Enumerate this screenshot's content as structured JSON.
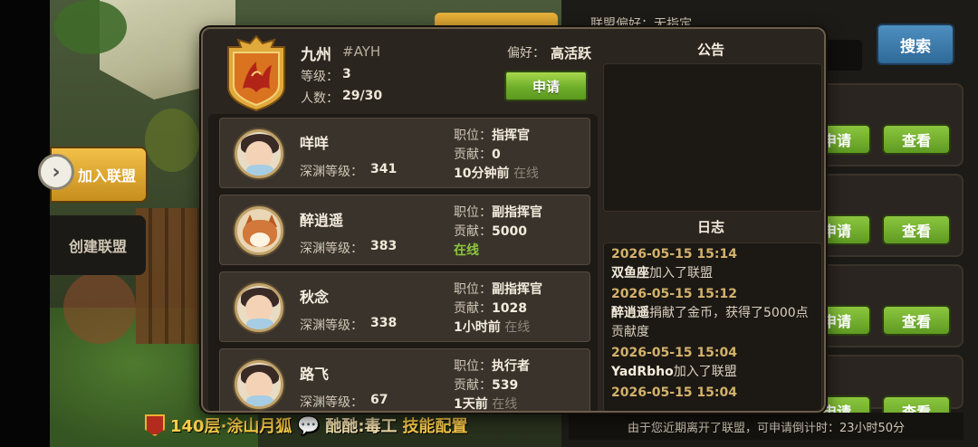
{
  "background": {
    "join_label": "加入联盟",
    "create_label": "创建联盟",
    "search_label": "搜索",
    "right_pref_text": "联盟偏好：无指定",
    "right_buttons": [
      {
        "apply": "申请",
        "view": "查看"
      },
      {
        "apply": "申请",
        "view": "查看"
      },
      {
        "apply": "申请",
        "view": "查看"
      },
      {
        "apply": "申请",
        "view": "查看"
      }
    ],
    "chat_text": "140层·涂山月狐",
    "chat_user": "酏酏:毒工",
    "chat_tail": "技能配置",
    "cooldown_notice": "由于您近期离开了联盟，可申请倒计时：23小时50分"
  },
  "guild": {
    "name": "九州",
    "tag": "#AYH",
    "level_label": "等级：",
    "level": "3",
    "members_label": "人数：",
    "members": "29/30",
    "preference_label": "偏好：",
    "preference": "高活跃",
    "apply_button": "申请"
  },
  "members": [
    {
      "name": "咩咩",
      "abyss_label": "深渊等级：",
      "abyss": "341",
      "role_label": "职位：",
      "role": "指挥官",
      "contrib_label": "贡献：",
      "contrib": "0",
      "last_seen": "10分钟前",
      "status": "在线",
      "avatar": "hero"
    },
    {
      "name": "醉逍遥",
      "abyss_label": "深渊等级：",
      "abyss": "383",
      "role_label": "职位：",
      "role": "副指挥官",
      "contrib_label": "贡献：",
      "contrib": "5000",
      "last_seen": "",
      "status": "在线",
      "avatar": "fox"
    },
    {
      "name": "秋念",
      "abyss_label": "深渊等级：",
      "abyss": "338",
      "role_label": "职位：",
      "role": "副指挥官",
      "contrib_label": "贡献：",
      "contrib": "1028",
      "last_seen": "1小时前",
      "status": "在线",
      "avatar": "hero"
    },
    {
      "name": "路飞",
      "abyss_label": "深渊等级：",
      "abyss": "67",
      "role_label": "职位：",
      "role": "执行者",
      "contrib_label": "贡献：",
      "contrib": "539",
      "last_seen": "1天前",
      "status": "在线",
      "avatar": "hero"
    }
  ],
  "announcement": {
    "title": "公告",
    "body": ""
  },
  "log": {
    "title": "日志",
    "entries": [
      {
        "time": "2026-05-15 15:14",
        "actor": "双鱼座",
        "text": "加入了联盟"
      },
      {
        "time": "2026-05-15 15:12",
        "actor": "醉逍遥",
        "text": "捐献了金币，获得了5000点贡献度"
      },
      {
        "time": "2026-05-15 15:04",
        "actor": "YadRbho",
        "text": "加入了联盟"
      },
      {
        "time": "2026-05-15 15:04",
        "actor": "",
        "text": ""
      }
    ]
  },
  "colors": {
    "accent_gold": "#f2c048",
    "apply_green": "#8cc63f",
    "online_green": "#8cc63f",
    "log_time": "#d3b26a",
    "search_blue": "#4d8fc0"
  }
}
